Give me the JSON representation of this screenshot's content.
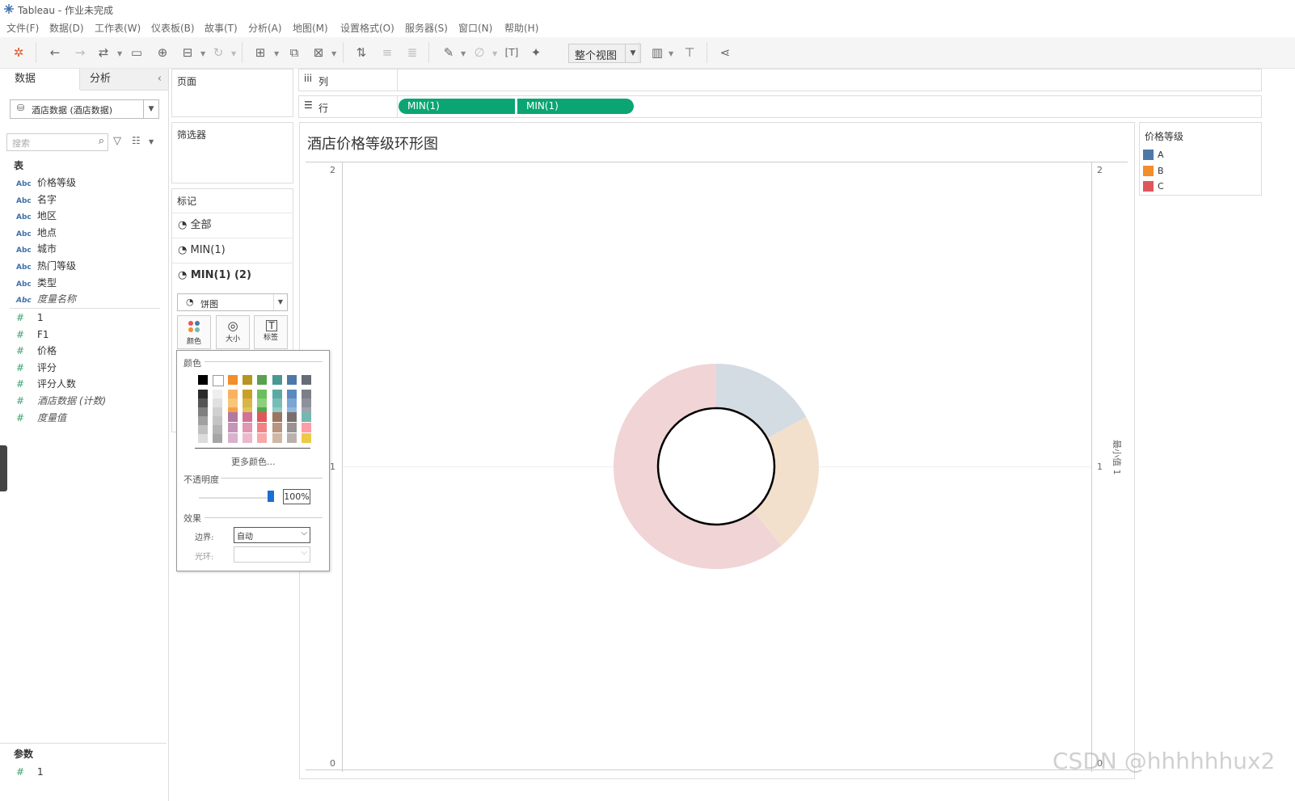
{
  "window": {
    "title": "Tableau - 作业未完成"
  },
  "menu": [
    "文件(F)",
    "数据(D)",
    "工作表(W)",
    "仪表板(B)",
    "故事(T)",
    "分析(A)",
    "地图(M)",
    "设置格式(O)",
    "服务器(S)",
    "窗口(N)",
    "帮助(H)"
  ],
  "toolbar": {
    "fit_label": "整个视图"
  },
  "data_pane": {
    "tabs": [
      "数据",
      "分析"
    ],
    "datasource": "酒店数据 (酒店数据)",
    "search_placeholder": "搜索",
    "section_table": "表",
    "dimensions": [
      {
        "type": "Abc",
        "name": "价格等级",
        "italic": false
      },
      {
        "type": "Abc",
        "name": "名字",
        "italic": false
      },
      {
        "type": "Abc",
        "name": "地区",
        "italic": false
      },
      {
        "type": "Abc",
        "name": "地点",
        "italic": false
      },
      {
        "type": "Abc",
        "name": "城市",
        "italic": false
      },
      {
        "type": "Abc",
        "name": "热门等级",
        "italic": false
      },
      {
        "type": "Abc",
        "name": "类型",
        "italic": false
      },
      {
        "type": "Abc",
        "name": "度量名称",
        "italic": true
      }
    ],
    "measures": [
      {
        "type": "#",
        "name": "1",
        "italic": false
      },
      {
        "type": "#",
        "name": "F1",
        "italic": false
      },
      {
        "type": "#",
        "name": "价格",
        "italic": false
      },
      {
        "type": "#",
        "name": "评分",
        "italic": false
      },
      {
        "type": "#",
        "name": "评分人数",
        "italic": false
      },
      {
        "type": "#",
        "name": "酒店数据 (计数)",
        "italic": true
      },
      {
        "type": "#",
        "name": "度量值",
        "italic": true
      }
    ],
    "params_title": "参数",
    "params": [
      {
        "type": "#",
        "name": "1"
      }
    ]
  },
  "shelves": {
    "pages": "页面",
    "filters": "筛选器",
    "columns_label": "列",
    "rows_label": "行",
    "rows_pills": [
      "MIN(1)",
      "MIN(1)"
    ]
  },
  "marks": {
    "title": "标记",
    "rows": [
      "全部",
      "MIN(1)",
      "MIN(1) (2)"
    ],
    "mark_type": "饼图",
    "buttons": [
      "颜色",
      "大小",
      "标签"
    ]
  },
  "color_popup": {
    "section_color": "颜色",
    "more_colors": "更多颜色...",
    "opacity_label": "不透明度",
    "opacity_value": "100%",
    "opacity": 1.0,
    "effects_label": "效果",
    "border_label": "边界:",
    "border_value": "自动",
    "halo_label": "光环:",
    "halo_value": "",
    "palette_top": [
      "#000000",
      "#ffffff",
      "#f28e2b",
      "#b69522",
      "#59a14f",
      "#499894",
      "#4e79a7",
      "#666c76"
    ],
    "palette_grays": [
      "#2b2b2b",
      "#555555",
      "#7f7f7f",
      "#a0a0a0",
      "#c0c0c0",
      "#dcdcdc"
    ]
  },
  "view": {
    "title": "酒店价格等级环形图",
    "left_axis_ticks": [
      "2",
      "1",
      "0"
    ],
    "right_axis_ticks": [
      "2",
      "1",
      "0"
    ],
    "right_axis_label": "最小值 1"
  },
  "legend": {
    "title": "价格等级",
    "items": [
      {
        "label": "A",
        "color": "#4e79a7"
      },
      {
        "label": "B",
        "color": "#f28e2b"
      },
      {
        "label": "C",
        "color": "#e15759"
      }
    ]
  },
  "chart_data": {
    "type": "pie",
    "title": "酒店价格等级环形图",
    "series": [
      {
        "name": "MIN(1)",
        "categories": [
          "A",
          "B",
          "C"
        ],
        "values": [
          17,
          22,
          61
        ],
        "colors": [
          "#d3dbe3",
          "#f3e0cc",
          "#f0d4d6"
        ]
      },
      {
        "name": "MIN(1) (2)",
        "values": [
          1
        ],
        "colors": [
          "#ffffff"
        ]
      }
    ],
    "ylim": [
      0,
      2
    ]
  },
  "watermark": "CSDN @hhhhhhux2"
}
